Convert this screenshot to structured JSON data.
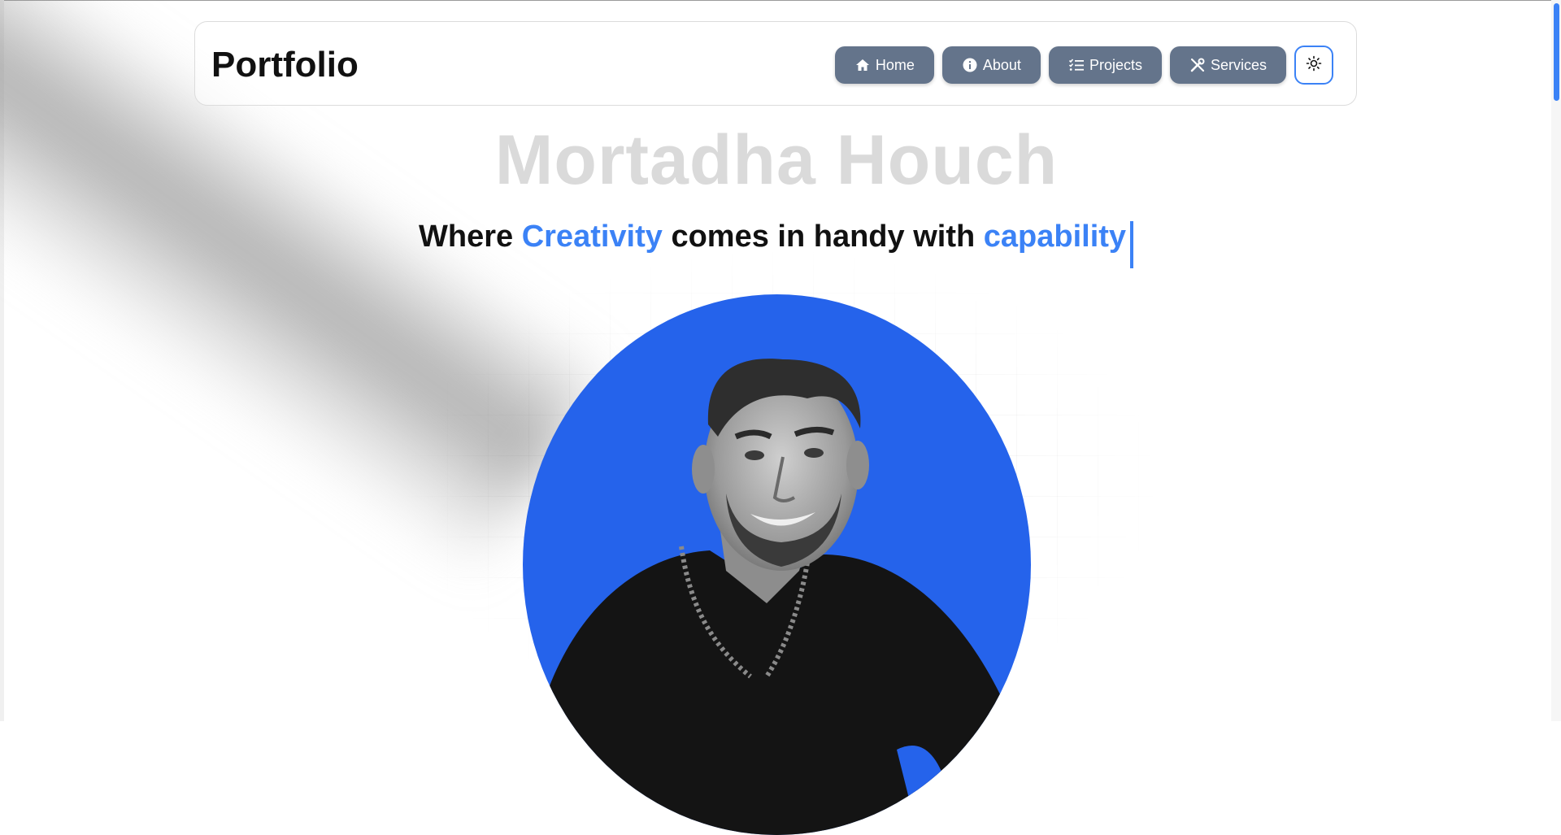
{
  "navbar": {
    "brand": "Portfolio",
    "links": [
      {
        "label": "Home",
        "icon": "home-icon"
      },
      {
        "label": "About",
        "icon": "info-icon"
      },
      {
        "label": "Projects",
        "icon": "list-check-icon"
      },
      {
        "label": "Services",
        "icon": "tools-icon"
      }
    ],
    "theme_toggle_icon": "sun-icon"
  },
  "hero": {
    "name": "Mortadha Houch",
    "tagline": {
      "part1": "Where ",
      "word1": "Creativity",
      "part2": " comes in handy with ",
      "word2": "capability"
    },
    "photo_alt": "Portrait of Mortadha Houch"
  },
  "colors": {
    "accent": "#3b82f6",
    "photo_background": "#2563eb",
    "nav_button": "#64748b"
  }
}
